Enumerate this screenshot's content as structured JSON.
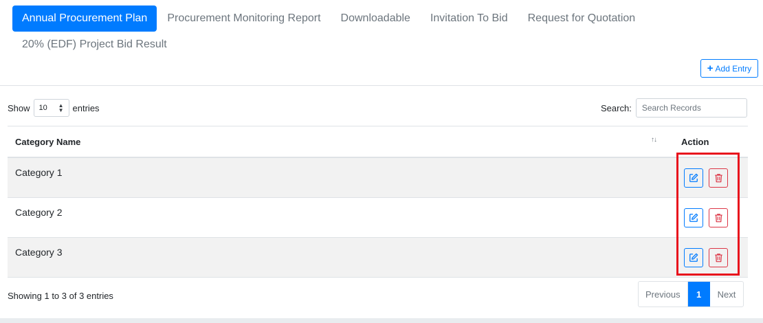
{
  "tabs": [
    {
      "label": "Annual Procurement Plan",
      "active": true
    },
    {
      "label": "Procurement Monitoring Report",
      "active": false
    },
    {
      "label": "Downloadable",
      "active": false
    },
    {
      "label": "Invitation To Bid",
      "active": false
    },
    {
      "label": "Request for Quotation",
      "active": false
    },
    {
      "label": "20% (EDF) Project Bid Result",
      "active": false
    }
  ],
  "toolbar": {
    "add_label": "Add Entry"
  },
  "length": {
    "show_label": "Show",
    "value": "10",
    "entries_label": "entries"
  },
  "search": {
    "label": "Search:",
    "placeholder": "Search Records"
  },
  "table": {
    "headers": {
      "name": "Category Name",
      "action": "Action"
    },
    "rows": [
      {
        "name": "Category 1"
      },
      {
        "name": "Category 2"
      },
      {
        "name": "Category 3"
      }
    ]
  },
  "footer": {
    "info": "Showing 1 to 3 of 3 entries",
    "prev": "Previous",
    "page": "1",
    "next": "Next"
  },
  "colors": {
    "primary": "#007bff",
    "danger": "#dc3545",
    "highlight": "#e8101c"
  }
}
